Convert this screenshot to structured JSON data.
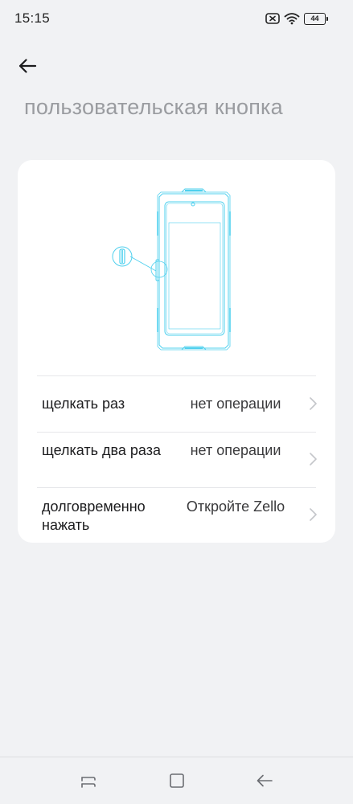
{
  "status_bar": {
    "time": "15:15",
    "battery_level": "44",
    "icons": [
      "sim-off-icon",
      "wifi-icon",
      "battery-icon"
    ]
  },
  "header": {
    "back_icon": "arrow-left-icon",
    "title": "пользовательская кнопка"
  },
  "illustration": {
    "icon": "phone-side-button-illustration",
    "accent_color": "#4fd0ee"
  },
  "settings": {
    "rows": [
      {
        "label": "щелкать раз",
        "value": "нет операции"
      },
      {
        "label": "щелкать два раза",
        "value": "нет операции"
      },
      {
        "label": "долговременно нажать",
        "value": "Откройте Zello"
      }
    ]
  },
  "nav_bar": {
    "icons": [
      "recent-apps-icon",
      "home-icon",
      "back-nav-icon"
    ]
  },
  "colors": {
    "background": "#f1f2f4",
    "card": "#ffffff",
    "title_gray": "#9a9ca0",
    "chevron": "#c4c6ca"
  }
}
